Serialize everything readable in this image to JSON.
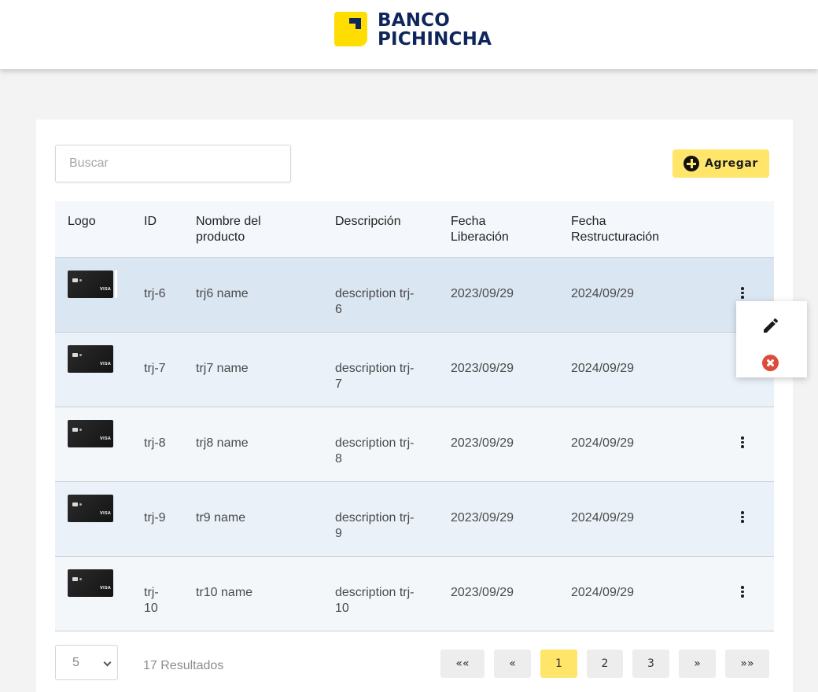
{
  "brand": {
    "line1": "BANCO",
    "line2": "PICHINCHA",
    "accent_color": "#ffdd00",
    "navy_color": "#0f265c"
  },
  "search": {
    "placeholder": "Buscar",
    "value": ""
  },
  "add_button": {
    "label": "Agregar",
    "icon": "plus-circle-icon",
    "color": "#ffe66b"
  },
  "table": {
    "headers": {
      "logo": "Logo",
      "id": "ID",
      "name_l1": "Nombre del",
      "name_l2": "producto",
      "desc": "Descripción",
      "lib_l1": "Fecha",
      "lib_l2": "Liberación",
      "res_l1": "Fecha",
      "res_l2": "Restructuración"
    },
    "rows": [
      {
        "logo_alt": "VISA",
        "id_l1": "trj-6",
        "id_l2": "",
        "name": "trj6 name",
        "desc_l1": "description trj-",
        "desc_l2": "6",
        "fecha_liberacion": "2023/09/29",
        "fecha_restructuracion": "2024/09/29"
      },
      {
        "logo_alt": "VISA",
        "id_l1": "trj-7",
        "id_l2": "",
        "name": "trj7 name",
        "desc_l1": "description trj-",
        "desc_l2": "7",
        "fecha_liberacion": "2023/09/29",
        "fecha_restructuracion": "2024/09/29"
      },
      {
        "logo_alt": "VISA",
        "id_l1": "trj-8",
        "id_l2": "",
        "name": "trj8 name",
        "desc_l1": "description trj-",
        "desc_l2": "8",
        "fecha_liberacion": "2023/09/29",
        "fecha_restructuracion": "2024/09/29"
      },
      {
        "logo_alt": "VISA",
        "id_l1": "trj-9",
        "id_l2": "",
        "name": "tr9 name",
        "desc_l1": "description trj-",
        "desc_l2": "9",
        "fecha_liberacion": "2023/09/29",
        "fecha_restructuracion": "2024/09/29"
      },
      {
        "logo_alt": "VISA",
        "id_l1": "trj-",
        "id_l2": "10",
        "name": "tr10 name",
        "desc_l1": "description trj-",
        "desc_l2": "10",
        "fecha_liberacion": "2023/09/29",
        "fecha_restructuracion": "2024/09/29"
      }
    ]
  },
  "row_menu": {
    "open_for_row": 0,
    "actions": [
      "pencil-icon",
      "close-circle-icon"
    ]
  },
  "pagination": {
    "page_size": "5",
    "results": "17 Resultados",
    "first": "««",
    "prev": "«",
    "pages": [
      "1",
      "2",
      "3"
    ],
    "current_page": "1",
    "next": "»",
    "last": "»»"
  }
}
